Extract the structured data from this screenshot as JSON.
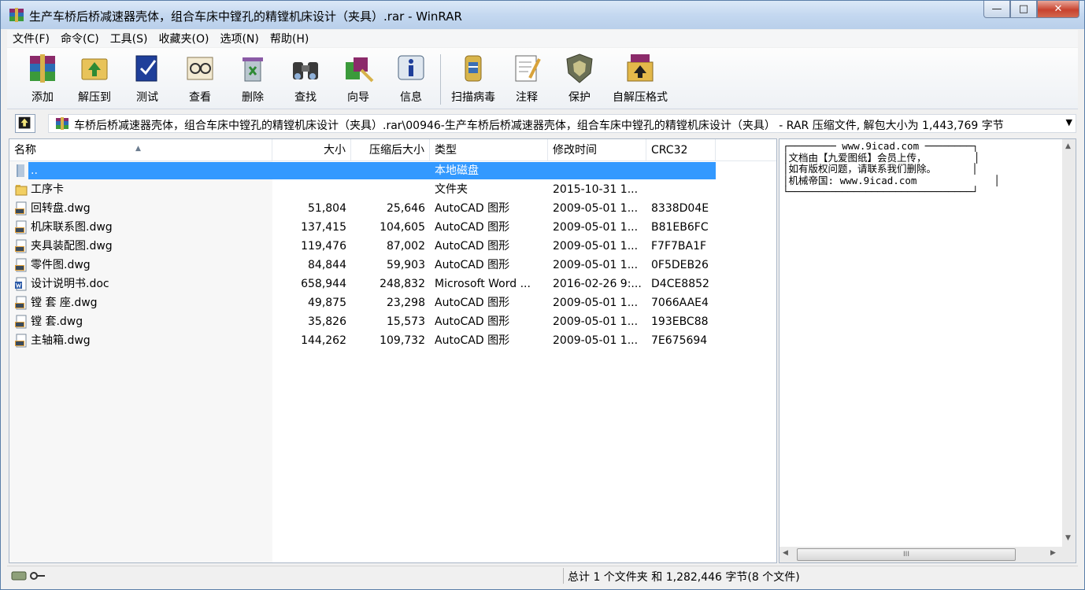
{
  "window": {
    "title": "生产车桥后桥减速器壳体，组合车床中镗孔的精镗机床设计（夹具）.rar - WinRAR",
    "minimize_glyph": "—",
    "maximize_glyph": "□",
    "close_glyph": "✕"
  },
  "menu": [
    "文件(F)",
    "命令(C)",
    "工具(S)",
    "收藏夹(O)",
    "选项(N)",
    "帮助(H)"
  ],
  "toolbar": {
    "buttons": [
      {
        "label": "添加",
        "icon": "add-archive-icon"
      },
      {
        "label": "解压到",
        "icon": "extract-to-icon"
      },
      {
        "label": "测试",
        "icon": "test-icon"
      },
      {
        "label": "查看",
        "icon": "view-icon"
      },
      {
        "label": "删除",
        "icon": "delete-icon"
      },
      {
        "label": "查找",
        "icon": "find-icon"
      },
      {
        "label": "向导",
        "icon": "wizard-icon"
      },
      {
        "label": "信息",
        "icon": "info-icon"
      },
      {
        "label": "扫描病毒",
        "icon": "virus-scan-icon"
      },
      {
        "label": "注释",
        "icon": "comment-icon"
      },
      {
        "label": "保护",
        "icon": "protect-icon"
      },
      {
        "label": "自解压格式",
        "icon": "sfx-icon"
      }
    ]
  },
  "address": {
    "path": "车桥后桥减速器壳体，组合车床中镗孔的精镗机床设计（夹具）.rar\\00946-生产车桥后桥减速器壳体，组合车床中镗孔的精镗机床设计（夹具） - RAR 压缩文件, 解包大小为 1,443,769 字节",
    "dropdown_glyph": "▼"
  },
  "filelist": {
    "columns": [
      "名称",
      "大小",
      "压缩后大小",
      "类型",
      "修改时间",
      "CRC32"
    ],
    "sort_glyph": "▲",
    "rows": [
      {
        "name": "..",
        "size": "",
        "packed": "",
        "type": "本地磁盘",
        "modified": "",
        "crc": "",
        "icon": "parent-folder-icon",
        "selected": true
      },
      {
        "name": "工序卡",
        "size": "",
        "packed": "",
        "type": "文件夹",
        "modified": "2015-10-31 1...",
        "crc": "",
        "icon": "folder-icon"
      },
      {
        "name": "回转盘.dwg",
        "size": "51,804",
        "packed": "25,646",
        "type": "AutoCAD 图形",
        "modified": "2009-05-01 1...",
        "crc": "8338D04E",
        "icon": "dwg-file-icon"
      },
      {
        "name": "机床联系图.dwg",
        "size": "137,415",
        "packed": "104,605",
        "type": "AutoCAD 图形",
        "modified": "2009-05-01 1...",
        "crc": "B81EB6FC",
        "icon": "dwg-file-icon"
      },
      {
        "name": "夹具装配图.dwg",
        "size": "119,476",
        "packed": "87,002",
        "type": "AutoCAD 图形",
        "modified": "2009-05-01 1...",
        "crc": "F7F7BA1F",
        "icon": "dwg-file-icon"
      },
      {
        "name": "零件图.dwg",
        "size": "84,844",
        "packed": "59,903",
        "type": "AutoCAD 图形",
        "modified": "2009-05-01 1...",
        "crc": "0F5DEB26",
        "icon": "dwg-file-icon"
      },
      {
        "name": "设计说明书.doc",
        "size": "658,944",
        "packed": "248,832",
        "type": "Microsoft Word ...",
        "modified": "2016-02-26 9:...",
        "crc": "D4CE8852",
        "icon": "word-doc-icon"
      },
      {
        "name": "镗 套 座.dwg",
        "size": "49,875",
        "packed": "23,298",
        "type": "AutoCAD 图形",
        "modified": "2009-05-01 1...",
        "crc": "7066AAE4",
        "icon": "dwg-file-icon"
      },
      {
        "name": "镗 套.dwg",
        "size": "35,826",
        "packed": "15,573",
        "type": "AutoCAD 图形",
        "modified": "2009-05-01 1...",
        "crc": "193EBC88",
        "icon": "dwg-file-icon"
      },
      {
        "name": "主轴箱.dwg",
        "size": "144,262",
        "packed": "109,732",
        "type": "AutoCAD 图形",
        "modified": "2009-05-01 1...",
        "crc": "7E675694",
        "icon": "dwg-file-icon"
      }
    ]
  },
  "comment": {
    "text": "┌──────── www.9icad.com ────────┐\n│文档由【九爱图纸】会员上传，        │\n│如有版权问题，请联系我们删除。      │\n│机械帝国: www.9icad.com             │\n└───────────────────────────────┘",
    "scroll_up": "▲",
    "scroll_down": "▼",
    "scroll_left": "◀",
    "scroll_right": "▶",
    "thumb_grip": "III"
  },
  "status": {
    "text": "总计 1 个文件夹 和 1,282,446 字节(8 个文件)"
  },
  "colors": {
    "selection": "#3399ff",
    "titlebar": "#c4d8f0"
  }
}
